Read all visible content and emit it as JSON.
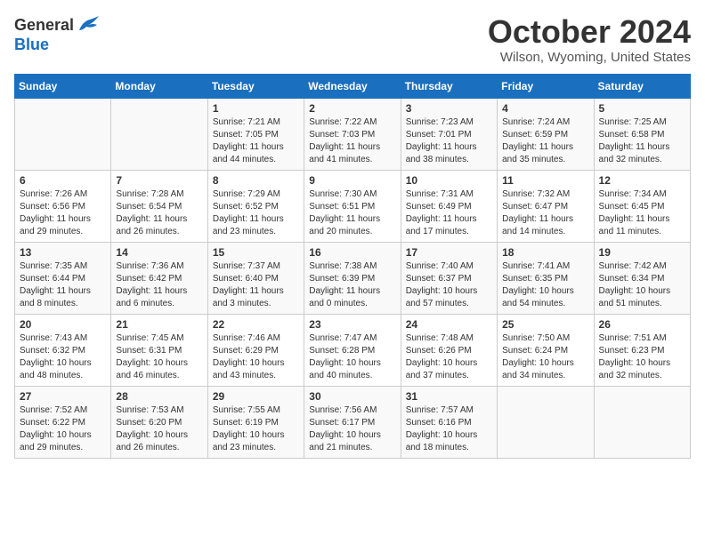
{
  "header": {
    "logo": {
      "general": "General",
      "blue": "Blue"
    },
    "title": "October 2024",
    "location": "Wilson, Wyoming, United States"
  },
  "calendar": {
    "weekdays": [
      "Sunday",
      "Monday",
      "Tuesday",
      "Wednesday",
      "Thursday",
      "Friday",
      "Saturday"
    ],
    "weeks": [
      [
        {
          "day": "",
          "info": ""
        },
        {
          "day": "",
          "info": ""
        },
        {
          "day": "1",
          "info": "Sunrise: 7:21 AM\nSunset: 7:05 PM\nDaylight: 11 hours and 44 minutes."
        },
        {
          "day": "2",
          "info": "Sunrise: 7:22 AM\nSunset: 7:03 PM\nDaylight: 11 hours and 41 minutes."
        },
        {
          "day": "3",
          "info": "Sunrise: 7:23 AM\nSunset: 7:01 PM\nDaylight: 11 hours and 38 minutes."
        },
        {
          "day": "4",
          "info": "Sunrise: 7:24 AM\nSunset: 6:59 PM\nDaylight: 11 hours and 35 minutes."
        },
        {
          "day": "5",
          "info": "Sunrise: 7:25 AM\nSunset: 6:58 PM\nDaylight: 11 hours and 32 minutes."
        }
      ],
      [
        {
          "day": "6",
          "info": "Sunrise: 7:26 AM\nSunset: 6:56 PM\nDaylight: 11 hours and 29 minutes."
        },
        {
          "day": "7",
          "info": "Sunrise: 7:28 AM\nSunset: 6:54 PM\nDaylight: 11 hours and 26 minutes."
        },
        {
          "day": "8",
          "info": "Sunrise: 7:29 AM\nSunset: 6:52 PM\nDaylight: 11 hours and 23 minutes."
        },
        {
          "day": "9",
          "info": "Sunrise: 7:30 AM\nSunset: 6:51 PM\nDaylight: 11 hours and 20 minutes."
        },
        {
          "day": "10",
          "info": "Sunrise: 7:31 AM\nSunset: 6:49 PM\nDaylight: 11 hours and 17 minutes."
        },
        {
          "day": "11",
          "info": "Sunrise: 7:32 AM\nSunset: 6:47 PM\nDaylight: 11 hours and 14 minutes."
        },
        {
          "day": "12",
          "info": "Sunrise: 7:34 AM\nSunset: 6:45 PM\nDaylight: 11 hours and 11 minutes."
        }
      ],
      [
        {
          "day": "13",
          "info": "Sunrise: 7:35 AM\nSunset: 6:44 PM\nDaylight: 11 hours and 8 minutes."
        },
        {
          "day": "14",
          "info": "Sunrise: 7:36 AM\nSunset: 6:42 PM\nDaylight: 11 hours and 6 minutes."
        },
        {
          "day": "15",
          "info": "Sunrise: 7:37 AM\nSunset: 6:40 PM\nDaylight: 11 hours and 3 minutes."
        },
        {
          "day": "16",
          "info": "Sunrise: 7:38 AM\nSunset: 6:39 PM\nDaylight: 11 hours and 0 minutes."
        },
        {
          "day": "17",
          "info": "Sunrise: 7:40 AM\nSunset: 6:37 PM\nDaylight: 10 hours and 57 minutes."
        },
        {
          "day": "18",
          "info": "Sunrise: 7:41 AM\nSunset: 6:35 PM\nDaylight: 10 hours and 54 minutes."
        },
        {
          "day": "19",
          "info": "Sunrise: 7:42 AM\nSunset: 6:34 PM\nDaylight: 10 hours and 51 minutes."
        }
      ],
      [
        {
          "day": "20",
          "info": "Sunrise: 7:43 AM\nSunset: 6:32 PM\nDaylight: 10 hours and 48 minutes."
        },
        {
          "day": "21",
          "info": "Sunrise: 7:45 AM\nSunset: 6:31 PM\nDaylight: 10 hours and 46 minutes."
        },
        {
          "day": "22",
          "info": "Sunrise: 7:46 AM\nSunset: 6:29 PM\nDaylight: 10 hours and 43 minutes."
        },
        {
          "day": "23",
          "info": "Sunrise: 7:47 AM\nSunset: 6:28 PM\nDaylight: 10 hours and 40 minutes."
        },
        {
          "day": "24",
          "info": "Sunrise: 7:48 AM\nSunset: 6:26 PM\nDaylight: 10 hours and 37 minutes."
        },
        {
          "day": "25",
          "info": "Sunrise: 7:50 AM\nSunset: 6:24 PM\nDaylight: 10 hours and 34 minutes."
        },
        {
          "day": "26",
          "info": "Sunrise: 7:51 AM\nSunset: 6:23 PM\nDaylight: 10 hours and 32 minutes."
        }
      ],
      [
        {
          "day": "27",
          "info": "Sunrise: 7:52 AM\nSunset: 6:22 PM\nDaylight: 10 hours and 29 minutes."
        },
        {
          "day": "28",
          "info": "Sunrise: 7:53 AM\nSunset: 6:20 PM\nDaylight: 10 hours and 26 minutes."
        },
        {
          "day": "29",
          "info": "Sunrise: 7:55 AM\nSunset: 6:19 PM\nDaylight: 10 hours and 23 minutes."
        },
        {
          "day": "30",
          "info": "Sunrise: 7:56 AM\nSunset: 6:17 PM\nDaylight: 10 hours and 21 minutes."
        },
        {
          "day": "31",
          "info": "Sunrise: 7:57 AM\nSunset: 6:16 PM\nDaylight: 10 hours and 18 minutes."
        },
        {
          "day": "",
          "info": ""
        },
        {
          "day": "",
          "info": ""
        }
      ]
    ]
  }
}
